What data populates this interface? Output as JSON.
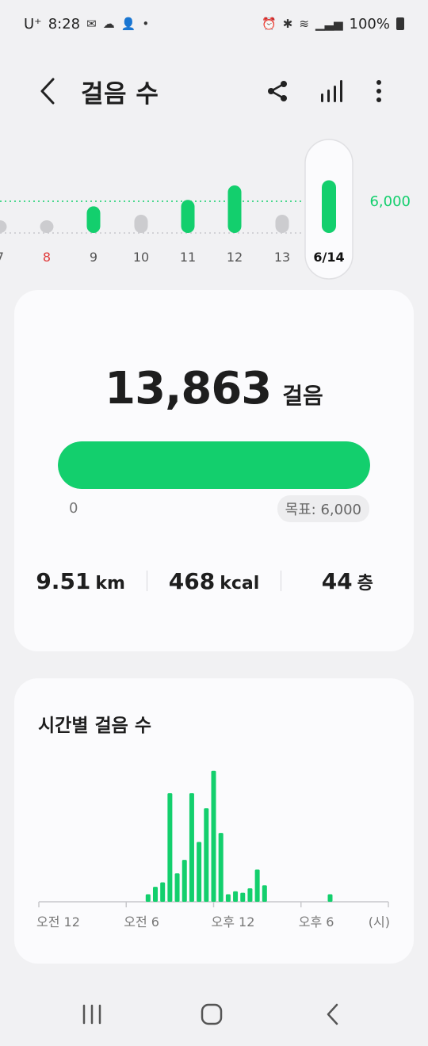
{
  "status_bar": {
    "carrier": "U⁺",
    "time": "8:28",
    "battery": "100%"
  },
  "header": {
    "title": "걸음 수"
  },
  "week_strip": {
    "days": [
      {
        "label": "7",
        "steps": 2500,
        "goal_met": false,
        "holiday": false
      },
      {
        "label": "8",
        "steps": 2500,
        "goal_met": false,
        "holiday": true
      },
      {
        "label": "9",
        "steps": 7000,
        "goal_met": true,
        "holiday": false
      },
      {
        "label": "10",
        "steps": 4800,
        "goal_met": false,
        "holiday": false
      },
      {
        "label": "11",
        "steps": 8700,
        "goal_met": true,
        "holiday": false
      },
      {
        "label": "12",
        "steps": 12500,
        "goal_met": true,
        "holiday": false
      },
      {
        "label": "13",
        "steps": 4800,
        "goal_met": false,
        "holiday": false
      },
      {
        "label": "6/14",
        "steps": 13863,
        "goal_met": true,
        "holiday": false,
        "selected": true
      }
    ],
    "goal_label": "6,000",
    "goal": 6000
  },
  "summary": {
    "steps": "13,863",
    "steps_unit": "걸음",
    "progress_fraction": 1.0,
    "min_label": "0",
    "goal_label": "목표: 6,000",
    "distance": {
      "value": "9.51",
      "unit": "km"
    },
    "calories": {
      "value": "468",
      "unit": "kcal"
    },
    "floors": {
      "value": "44",
      "unit": "층"
    }
  },
  "hourly": {
    "title": "시간별 걸음 수"
  },
  "chart_data": {
    "type": "bar",
    "title": "시간별 걸음 수",
    "xlabel": "(시)",
    "ylabel": "",
    "x_tick_labels": [
      "오전 12",
      "오전 6",
      "오후 12",
      "오후 6",
      "(시)"
    ],
    "x_ticks_hours": [
      0,
      6,
      12,
      18,
      24
    ],
    "xlim": [
      0,
      24
    ],
    "bars": [
      {
        "hour": 7.5,
        "value": 100
      },
      {
        "hour": 8.0,
        "value": 200
      },
      {
        "hour": 8.5,
        "value": 260
      },
      {
        "hour": 9.0,
        "value": 1450
      },
      {
        "hour": 9.5,
        "value": 380
      },
      {
        "hour": 10.0,
        "value": 560
      },
      {
        "hour": 10.5,
        "value": 1450
      },
      {
        "hour": 11.0,
        "value": 800
      },
      {
        "hour": 11.5,
        "value": 1250
      },
      {
        "hour": 12.0,
        "value": 1750
      },
      {
        "hour": 12.5,
        "value": 920
      },
      {
        "hour": 13.0,
        "value": 100
      },
      {
        "hour": 13.5,
        "value": 140
      },
      {
        "hour": 14.0,
        "value": 120
      },
      {
        "hour": 14.5,
        "value": 180
      },
      {
        "hour": 15.0,
        "value": 430
      },
      {
        "hour": 15.5,
        "value": 220
      },
      {
        "hour": 20.0,
        "value": 100
      }
    ],
    "ylim": [
      0,
      1800
    ],
    "color": "#13cf6d"
  },
  "colors": {
    "accent": "#13cf6d",
    "inactive_bar": "#cccccf",
    "holiday_label": "#e03a3a"
  }
}
